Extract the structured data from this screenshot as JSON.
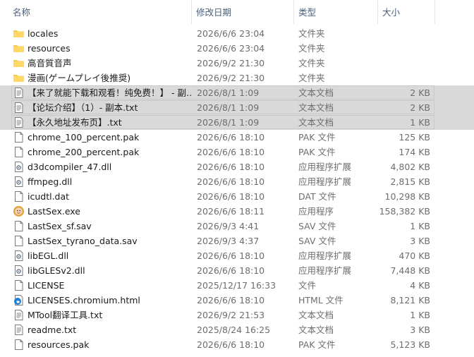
{
  "header": {
    "name": "名称",
    "date": "修改日期",
    "type": "类型",
    "size": "大小"
  },
  "rows": [
    {
      "name": "locales",
      "date": "2026/6/6 23:04",
      "type": "文件夹",
      "size": "",
      "icon": "folder-icon",
      "selected": false
    },
    {
      "name": "resources",
      "date": "2026/6/6 23:04",
      "type": "文件夹",
      "size": "",
      "icon": "folder-icon",
      "selected": false
    },
    {
      "name": "高音質音声",
      "date": "2026/9/2 21:30",
      "type": "文件夹",
      "size": "",
      "icon": "folder-icon",
      "selected": false
    },
    {
      "name": "漫画(ゲームプレイ後推奨)",
      "date": "2026/9/2 21:30",
      "type": "文件夹",
      "size": "",
      "icon": "folder-icon",
      "selected": false
    },
    {
      "name": "【来了就能下载和观看！纯免费！】 - 副…",
      "date": "2026/8/1 1:09",
      "type": "文本文档",
      "size": "2 KB",
      "icon": "text-file-icon",
      "selected": true
    },
    {
      "name": "【论坛介绍】（1）- 副本.txt",
      "date": "2026/8/1 1:09",
      "type": "文本文档",
      "size": "2 KB",
      "icon": "text-file-icon",
      "selected": true
    },
    {
      "name": "【永久地址发布页】.txt",
      "date": "2026/8/1 1:09",
      "type": "文本文档",
      "size": "1 KB",
      "icon": "text-file-icon",
      "selected": true
    },
    {
      "name": "chrome_100_percent.pak",
      "date": "2026/6/6 18:10",
      "type": "PAK 文件",
      "size": "125 KB",
      "icon": "blank-file-icon",
      "selected": false
    },
    {
      "name": "chrome_200_percent.pak",
      "date": "2026/6/6 18:10",
      "type": "PAK 文件",
      "size": "174 KB",
      "icon": "blank-file-icon",
      "selected": false
    },
    {
      "name": "d3dcompiler_47.dll",
      "date": "2026/6/6 18:10",
      "type": "应用程序扩展",
      "size": "4,802 KB",
      "icon": "dll-file-icon",
      "selected": false
    },
    {
      "name": "ffmpeg.dll",
      "date": "2026/6/6 18:10",
      "type": "应用程序扩展",
      "size": "2,815 KB",
      "icon": "dll-file-icon",
      "selected": false
    },
    {
      "name": "icudtl.dat",
      "date": "2026/6/6 18:10",
      "type": "DAT 文件",
      "size": "10,298 KB",
      "icon": "blank-file-icon",
      "selected": false
    },
    {
      "name": "LastSex.exe",
      "date": "2026/6/6 18:11",
      "type": "应用程序",
      "size": "158,382 KB",
      "icon": "app-exe-icon",
      "selected": false
    },
    {
      "name": "LastSex_sf.sav",
      "date": "2026/9/3 4:41",
      "type": "SAV 文件",
      "size": "1 KB",
      "icon": "blank-file-icon",
      "selected": false
    },
    {
      "name": "LastSex_tyrano_data.sav",
      "date": "2026/9/3 4:37",
      "type": "SAV 文件",
      "size": "3 KB",
      "icon": "blank-file-icon",
      "selected": false
    },
    {
      "name": "libEGL.dll",
      "date": "2026/6/6 18:10",
      "type": "应用程序扩展",
      "size": "470 KB",
      "icon": "dll-file-icon",
      "selected": false
    },
    {
      "name": "libGLESv2.dll",
      "date": "2026/6/6 18:10",
      "type": "应用程序扩展",
      "size": "7,448 KB",
      "icon": "dll-file-icon",
      "selected": false
    },
    {
      "name": "LICENSE",
      "date": "2025/12/17 16:33",
      "type": "文件",
      "size": "4 KB",
      "icon": "blank-file-icon",
      "selected": false
    },
    {
      "name": "LICENSES.chromium.html",
      "date": "2026/6/6 18:10",
      "type": "HTML 文件",
      "size": "8,121 KB",
      "icon": "edge-html-icon",
      "selected": false
    },
    {
      "name": "MTool翻译工具.txt",
      "date": "2026/9/2 21:53",
      "type": "文本文档",
      "size": "1 KB",
      "icon": "text-file-icon",
      "selected": false
    },
    {
      "name": "readme.txt",
      "date": "2025/8/24 16:25",
      "type": "文本文档",
      "size": "3 KB",
      "icon": "text-file-icon",
      "selected": false
    },
    {
      "name": "resources.pak",
      "date": "2026/6/6 18:10",
      "type": "PAK 文件",
      "size": "5,123 KB",
      "icon": "blank-file-icon",
      "selected": false
    }
  ],
  "colors": {
    "header_text": "#4c607a",
    "selection": "#d9d9d9",
    "folder": "#f7c94b",
    "secondary_text": "#6d6d6d"
  }
}
